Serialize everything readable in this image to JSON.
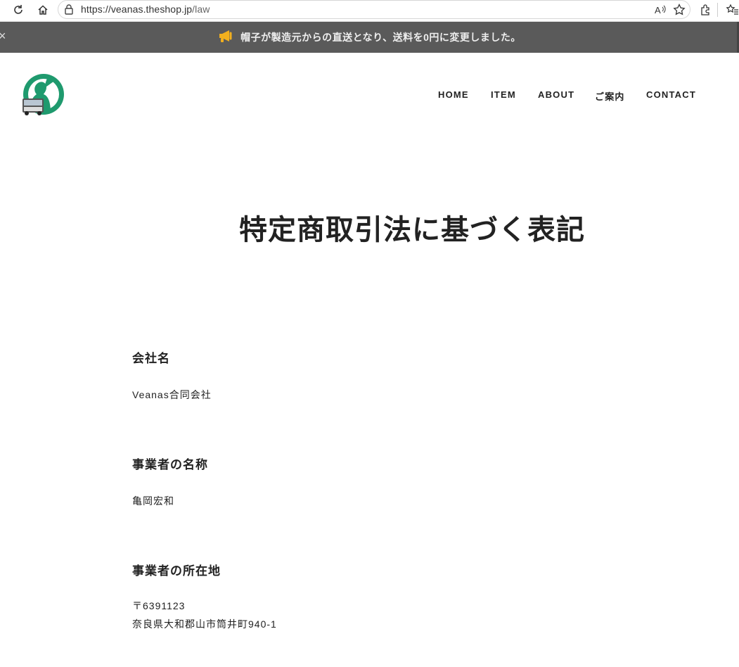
{
  "browser": {
    "url_main": "https://veanas.theshop.jp",
    "url_path": "/law"
  },
  "announcement": {
    "text": "帽子が製造元からの直送となり、送料を0円に変更しました。",
    "close_symbol": "×"
  },
  "header": {
    "nav": [
      "HOME",
      "ITEM",
      "ABOUT",
      "ご案内",
      "CONTACT"
    ]
  },
  "page": {
    "title": "特定商取引法に基づく表記",
    "sections": [
      {
        "heading": "会社名",
        "lines": [
          "Veanas合同会社"
        ]
      },
      {
        "heading": "事業者の名称",
        "lines": [
          "亀岡宏和"
        ]
      },
      {
        "heading": "事業者の所在地",
        "lines": [
          "〒6391123",
          "奈良県大和郡山市筒井町940-1"
        ]
      }
    ]
  },
  "colors": {
    "announcement_bg": "#5a5a5a",
    "megaphone": "#f2b01e",
    "logo_green": "#1f9a6e"
  }
}
